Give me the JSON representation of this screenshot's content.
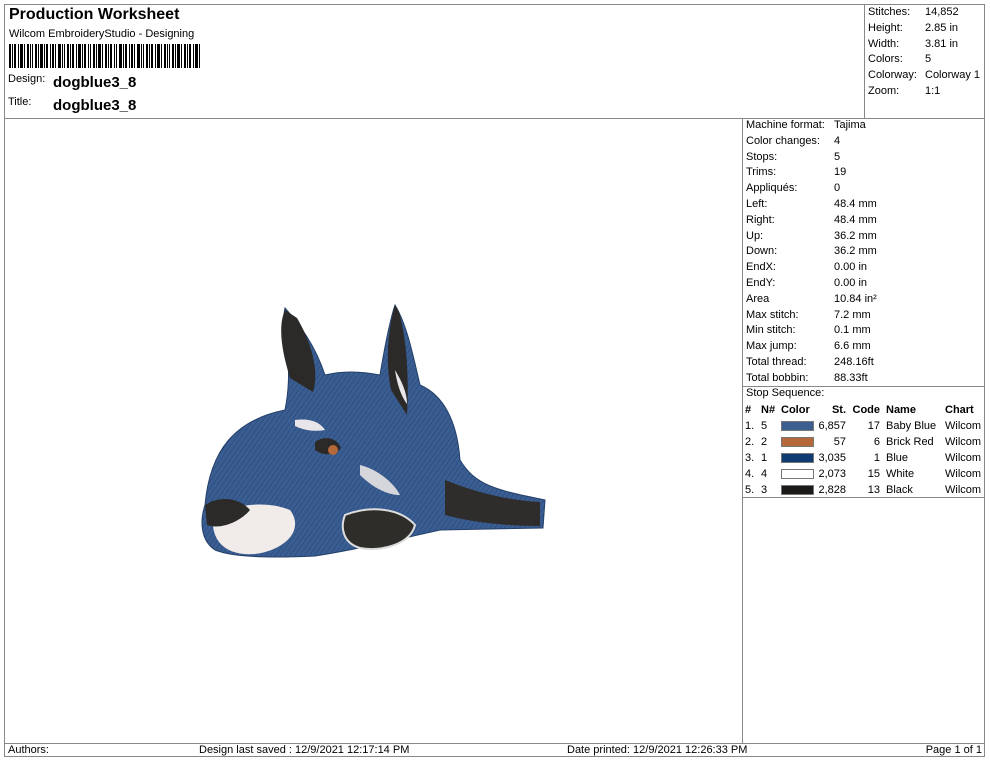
{
  "header": {
    "title": "Production Worksheet",
    "subtitle": "Wilcom EmbroideryStudio - Designing",
    "design_label": "Design:",
    "design_value": "dogblue3_8",
    "title_label": "Title:",
    "title_value": "dogblue3_8"
  },
  "summary": [
    {
      "k": "Stitches:",
      "v": "14,852"
    },
    {
      "k": "Height:",
      "v": "2.85 in"
    },
    {
      "k": "Width:",
      "v": "3.81 in"
    },
    {
      "k": "Colors:",
      "v": "5"
    },
    {
      "k": "Colorway:",
      "v": "Colorway 1"
    },
    {
      "k": "Zoom:",
      "v": "1:1"
    }
  ],
  "details": [
    {
      "k": "Machine format:",
      "v": "Tajima"
    },
    {
      "k": "Color changes:",
      "v": "4"
    },
    {
      "k": "Stops:",
      "v": "5"
    },
    {
      "k": "Trims:",
      "v": "19"
    },
    {
      "k": "Appliqués:",
      "v": "0"
    },
    {
      "k": "Left:",
      "v": "48.4 mm"
    },
    {
      "k": "Right:",
      "v": "48.4 mm"
    },
    {
      "k": "Up:",
      "v": "36.2 mm"
    },
    {
      "k": "Down:",
      "v": "36.2 mm"
    },
    {
      "k": "EndX:",
      "v": "0.00 in"
    },
    {
      "k": "EndY:",
      "v": "0.00 in"
    },
    {
      "k": "Area",
      "v": " 10.84 in²"
    },
    {
      "k": "Max stitch:",
      "v": "7.2 mm"
    },
    {
      "k": "Min stitch:",
      "v": "0.1 mm"
    },
    {
      "k": "Max jump:",
      "v": "6.6 mm"
    },
    {
      "k": "Total thread:",
      "v": "248.16ft"
    },
    {
      "k": "Total bobbin:",
      "v": "88.33ft"
    }
  ],
  "stop_sequence": {
    "label": "Stop Sequence:",
    "headers": {
      "idx": "#",
      "n": "N#",
      "color": "Color",
      "st": "St.",
      "code": "Code",
      "name": "Name",
      "chart": "Chart"
    },
    "rows": [
      {
        "idx": "1.",
        "n": "5",
        "swatch": "#3d5f8f",
        "st": "6,857",
        "code": "17",
        "name": "Baby Blue",
        "chart": "Wilcom"
      },
      {
        "idx": "2.",
        "n": "2",
        "swatch": "#b5683a",
        "st": "57",
        "code": "6",
        "name": "Brick Red",
        "chart": "Wilcom"
      },
      {
        "idx": "3.",
        "n": "1",
        "swatch": "#0f3a72",
        "st": "3,035",
        "code": "1",
        "name": "Blue",
        "chart": "Wilcom"
      },
      {
        "idx": "4.",
        "n": "4",
        "swatch": "#ffffff",
        "st": "2,073",
        "code": "15",
        "name": "White",
        "chart": "Wilcom"
      },
      {
        "idx": "5.",
        "n": "3",
        "swatch": "#1c1a18",
        "st": "2,828",
        "code": "13",
        "name": "Black",
        "chart": "Wilcom"
      }
    ]
  },
  "footer": {
    "authors": "Authors:",
    "saved": "Design last saved : 12/9/2021 12:17:14 PM",
    "printed": "Date printed: 12/9/2021 12:26:33 PM",
    "page": "Page 1 of 1"
  }
}
